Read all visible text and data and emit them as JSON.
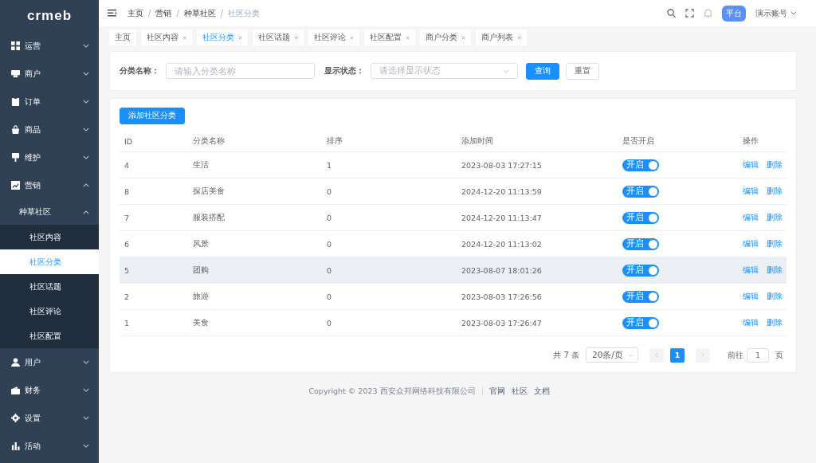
{
  "logo": "crmeb",
  "sidebar": {
    "items": [
      {
        "label": "运营",
        "expanded": false
      },
      {
        "label": "商户",
        "expanded": false
      },
      {
        "label": "订单",
        "expanded": false
      },
      {
        "label": "商品",
        "expanded": false
      },
      {
        "label": "维护",
        "expanded": false
      },
      {
        "label": "营销",
        "expanded": true,
        "children": [
          {
            "label": "种草社区",
            "expanded": true,
            "children": [
              {
                "label": "社区内容",
                "selected": false
              },
              {
                "label": "社区分类",
                "selected": true
              },
              {
                "label": "社区话题",
                "selected": false
              },
              {
                "label": "社区评论",
                "selected": false
              },
              {
                "label": "社区配置",
                "selected": false
              }
            ]
          }
        ]
      },
      {
        "label": "用户",
        "expanded": false
      },
      {
        "label": "财务",
        "expanded": false
      },
      {
        "label": "设置",
        "expanded": false
      },
      {
        "label": "活动",
        "expanded": false
      }
    ]
  },
  "breadcrumb": [
    {
      "kind": "link",
      "text": "主页"
    },
    {
      "kind": "separator",
      "text": "/"
    },
    {
      "kind": "link",
      "text": "营销"
    },
    {
      "kind": "separator",
      "text": "/"
    },
    {
      "kind": "link",
      "text": "种草社区"
    },
    {
      "kind": "separator",
      "text": "/"
    },
    {
      "kind": "current",
      "text": "社区分类"
    }
  ],
  "header": {
    "badge": "平台",
    "account": "演示账号"
  },
  "tabs": [
    {
      "label": "主页",
      "closable": false,
      "selected": false
    },
    {
      "label": "社区内容",
      "closable": true,
      "selected": false
    },
    {
      "label": "社区分类",
      "closable": true,
      "selected": true
    },
    {
      "label": "社区话题",
      "closable": true,
      "selected": false
    },
    {
      "label": "社区评论",
      "closable": true,
      "selected": false
    },
    {
      "label": "社区配置",
      "closable": true,
      "selected": false
    },
    {
      "label": "商户分类",
      "closable": true,
      "selected": false
    },
    {
      "label": "商户列表",
      "closable": true,
      "selected": false
    }
  ],
  "filters": {
    "name_label": "分类名称：",
    "name_placeholder": "请输入分类名称",
    "status_label": "显示状态：",
    "status_placeholder": "请选择显示状态",
    "search": "查询",
    "reset": "重置"
  },
  "add_button": "添加社区分类",
  "table": {
    "columns": [
      "ID",
      "分类名称",
      "排序",
      "添加时间",
      "是否开启",
      "操作"
    ],
    "rows": [
      {
        "id": "4",
        "name": "生活",
        "sort": "1",
        "time": "2023-08-03 17:27:15",
        "on": true,
        "toggle_label": "开启",
        "edit": "编辑",
        "delete": "删除",
        "highlighted": false
      },
      {
        "id": "8",
        "name": "探店美食",
        "sort": "0",
        "time": "2024-12-20 11:13:59",
        "on": true,
        "toggle_label": "开启",
        "edit": "编辑",
        "delete": "删除",
        "highlighted": false
      },
      {
        "id": "7",
        "name": "服装搭配",
        "sort": "0",
        "time": "2024-12-20 11:13:47",
        "on": true,
        "toggle_label": "开启",
        "edit": "编辑",
        "delete": "删除",
        "highlighted": false
      },
      {
        "id": "6",
        "name": "风景",
        "sort": "0",
        "time": "2024-12-20 11:13:02",
        "on": true,
        "toggle_label": "开启",
        "edit": "编辑",
        "delete": "删除",
        "highlighted": false
      },
      {
        "id": "5",
        "name": "团购",
        "sort": "0",
        "time": "2023-08-07 18:01:26",
        "on": true,
        "toggle_label": "开启",
        "edit": "编辑",
        "delete": "删除",
        "highlighted": true
      },
      {
        "id": "2",
        "name": "旅游",
        "sort": "0",
        "time": "2023-08-03 17:26:56",
        "on": true,
        "toggle_label": "开启",
        "edit": "编辑",
        "delete": "删除",
        "highlighted": false
      },
      {
        "id": "1",
        "name": "美食",
        "sort": "0",
        "time": "2023-08-03 17:26:47",
        "on": true,
        "toggle_label": "开启",
        "edit": "编辑",
        "delete": "删除",
        "highlighted": false
      }
    ]
  },
  "pagination": {
    "total": "共 7 条",
    "page_size": "20条/页",
    "pages": [
      {
        "label": "1",
        "selected": true
      }
    ],
    "goto_label": "前往",
    "goto_value": "1",
    "page_unit": "页"
  },
  "footer": {
    "copyright": "Copyright © 2023 西安众邦网络科技有限公司",
    "links": [
      "官网",
      "社区",
      "文档"
    ]
  }
}
